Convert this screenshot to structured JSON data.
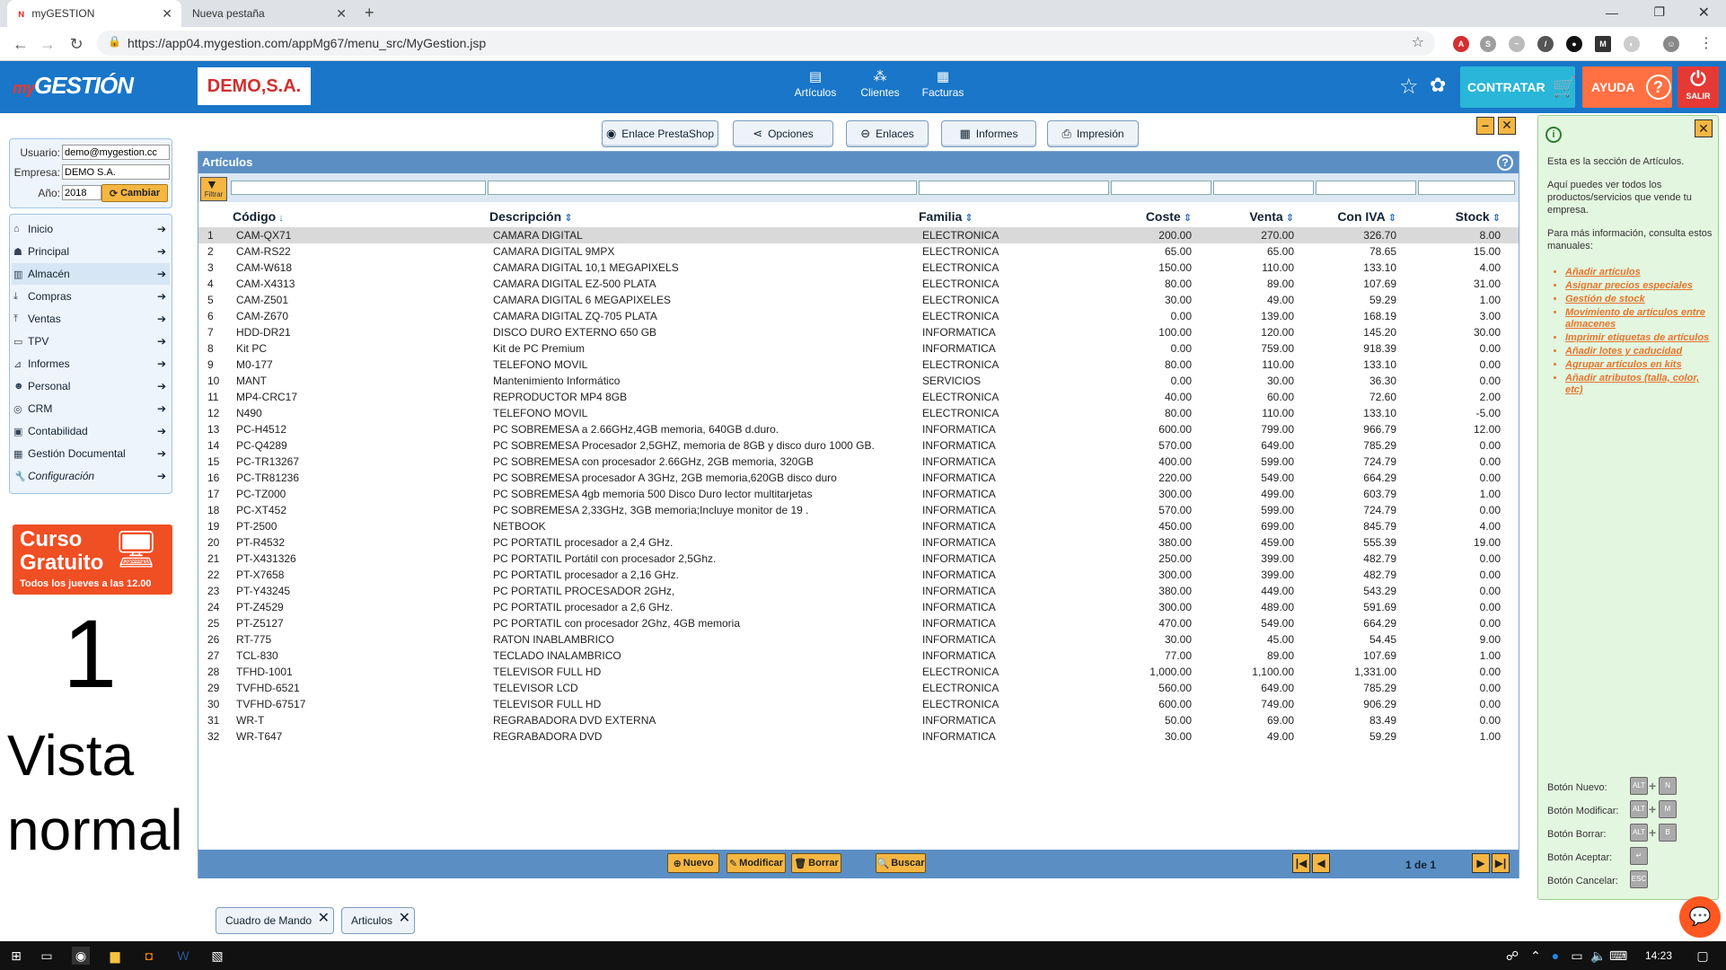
{
  "browser": {
    "tabs": [
      {
        "label": "myGESTION",
        "close": "✕"
      },
      {
        "label": "Nueva pestaña",
        "close": "✕"
      }
    ],
    "new_tab": "+",
    "url": "https://app04.mygestion.com/appMg67/menu_src/MyGestion.jsp"
  },
  "header": {
    "logo_prefix": "my",
    "logo": "GESTIÓN",
    "company_badge": "DEMO,S.A.",
    "nav": [
      {
        "label": "Artículos",
        "icon": "box-icon"
      },
      {
        "label": "Clientes",
        "icon": "people-icon"
      },
      {
        "label": "Facturas",
        "icon": "invoice-icon"
      }
    ],
    "contratar": "CONTRATAR",
    "ayuda": "AYUDA",
    "salir": "SALIR"
  },
  "login": {
    "usuario_label": "Usuario:",
    "usuario_value": "demo@mygestion.cc",
    "empresa_label": "Empresa:",
    "empresa_value": "DEMO S.A.",
    "anio_label": "Año:",
    "anio_value": "2018",
    "cambiar": "Cambiar"
  },
  "menu": [
    {
      "label": "Inicio"
    },
    {
      "label": "Principal"
    },
    {
      "label": "Almacén"
    },
    {
      "label": "Compras"
    },
    {
      "label": "Ventas"
    },
    {
      "label": "TPV"
    },
    {
      "label": "Informes"
    },
    {
      "label": "Personal"
    },
    {
      "label": "CRM"
    },
    {
      "label": "Contabilidad"
    },
    {
      "label": "Gestión Documental"
    },
    {
      "label": "Configuración"
    }
  ],
  "promo": {
    "line1": "Curso",
    "line2": "Gratuito",
    "line3": "Todos los jueves a las 12.00"
  },
  "overlay": {
    "number": "1",
    "line1": "Vista",
    "line2": "normal"
  },
  "toolbar": [
    "Enlace PrestaShop",
    "Opciones",
    "Enlaces",
    "Informes",
    "Impresión"
  ],
  "grid": {
    "title": "Artículos",
    "filter_label": "Filtrar",
    "columns": [
      "Código",
      "Descripción",
      "Familia",
      "Coste",
      "Venta",
      "Con IVA",
      "Stock"
    ],
    "rows": [
      [
        "1",
        "CAM-QX71",
        "CAMARA DIGITAL",
        "ELECTRONICA",
        "200.00",
        "270.00",
        "326.70",
        "8.00"
      ],
      [
        "2",
        "CAM-RS22",
        "CAMARA DIGITAL 9MPX",
        "ELECTRONICA",
        "65.00",
        "65.00",
        "78.65",
        "15.00"
      ],
      [
        "3",
        "CAM-W618",
        "CAMARA DIGITAL 10,1 MEGAPIXELS",
        "ELECTRONICA",
        "150.00",
        "110.00",
        "133.10",
        "4.00"
      ],
      [
        "4",
        "CAM-X4313",
        "CAMARA DIGITAL EZ-500 PLATA",
        "ELECTRONICA",
        "80.00",
        "89.00",
        "107.69",
        "31.00"
      ],
      [
        "5",
        "CAM-Z501",
        "CAMARA DIGITAL 6 MEGAPIXELES",
        "ELECTRONICA",
        "30.00",
        "49.00",
        "59.29",
        "1.00"
      ],
      [
        "6",
        "CAM-Z670",
        "CAMARA DIGITAL ZQ-705 PLATA",
        "ELECTRONICA",
        "0.00",
        "139.00",
        "168.19",
        "3.00"
      ],
      [
        "7",
        "HDD-DR21",
        "DISCO DURO EXTERNO 650 GB",
        "INFORMATICA",
        "100.00",
        "120.00",
        "145.20",
        "30.00"
      ],
      [
        "8",
        "Kit PC",
        "Kit de PC Premium",
        "INFORMATICA",
        "0.00",
        "759.00",
        "918.39",
        "0.00"
      ],
      [
        "9",
        "M0-177",
        "TELEFONO MOVIL",
        "ELECTRONICA",
        "80.00",
        "110.00",
        "133.10",
        "0.00"
      ],
      [
        "10",
        "MANT",
        "Mantenimiento Informático",
        "SERVICIOS",
        "0.00",
        "30.00",
        "36.30",
        "0.00"
      ],
      [
        "11",
        "MP4-CRC17",
        "REPRODUCTOR MP4 8GB",
        "ELECTRONICA",
        "40.00",
        "60.00",
        "72.60",
        "2.00"
      ],
      [
        "12",
        "N490",
        "TELEFONO MOVIL",
        "ELECTRONICA",
        "80.00",
        "110.00",
        "133.10",
        "-5.00"
      ],
      [
        "13",
        "PC-H4512",
        "PC SOBREMESA a 2.66GHz,4GB memoria, 640GB d.duro.",
        "INFORMATICA",
        "600.00",
        "799.00",
        "966.79",
        "12.00"
      ],
      [
        "14",
        "PC-Q4289",
        "PC SOBREMESA Procesador 2,5GHZ, memoria de 8GB y disco duro 1000 GB.",
        "INFORMATICA",
        "570.00",
        "649.00",
        "785.29",
        "0.00"
      ],
      [
        "15",
        "PC-TR13267",
        "PC SOBREMESA con procesador 2.66GHz, 2GB memoria, 320GB",
        "INFORMATICA",
        "400.00",
        "599.00",
        "724.79",
        "0.00"
      ],
      [
        "16",
        "PC-TR81236",
        "PC SOBREMESA procesador A 3GHz, 2GB memoria,620GB disco duro",
        "INFORMATICA",
        "220.00",
        "549.00",
        "664.29",
        "0.00"
      ],
      [
        "17",
        "PC-TZ000",
        "PC SOBREMESA 4gb memoria 500 Disco Duro lector multitarjetas",
        "INFORMATICA",
        "300.00",
        "499.00",
        "603.79",
        "1.00"
      ],
      [
        "18",
        "PC-XT452",
        "PC SOBREMESA 2,33GHz, 3GB memoria;Incluye monitor de 19 .",
        "INFORMATICA",
        "570.00",
        "599.00",
        "724.79",
        "0.00"
      ],
      [
        "19",
        "PT-2500",
        "NETBOOK",
        "INFORMATICA",
        "450.00",
        "699.00",
        "845.79",
        "4.00"
      ],
      [
        "20",
        "PT-R4532",
        "PC PORTATIL procesador a 2,4 GHz.",
        "INFORMATICA",
        "380.00",
        "459.00",
        "555.39",
        "19.00"
      ],
      [
        "21",
        "PT-X431326",
        "PC PORTATIL Portátil con procesador 2,5Ghz.",
        "INFORMATICA",
        "250.00",
        "399.00",
        "482.79",
        "0.00"
      ],
      [
        "22",
        "PT-X7658",
        "PC PORTATIL procesador a 2,16 GHz.",
        "INFORMATICA",
        "300.00",
        "399.00",
        "482.79",
        "0.00"
      ],
      [
        "23",
        "PT-Y43245",
        "PC PORTATIL PROCESADOR 2GHz,",
        "INFORMATICA",
        "380.00",
        "449.00",
        "543.29",
        "0.00"
      ],
      [
        "24",
        "PT-Z4529",
        "PC PORTATIL procesador a 2,6 GHz.",
        "INFORMATICA",
        "300.00",
        "489.00",
        "591.69",
        "0.00"
      ],
      [
        "25",
        "PT-Z5127",
        "PC PORTATIL con procesador 2Ghz, 4GB memoria",
        "INFORMATICA",
        "470.00",
        "549.00",
        "664.29",
        "0.00"
      ],
      [
        "26",
        "RT-775",
        "RATON INABLAMBRICO",
        "INFORMATICA",
        "30.00",
        "45.00",
        "54.45",
        "9.00"
      ],
      [
        "27",
        "TCL-830",
        "TECLADO INALAMBRICO",
        "INFORMATICA",
        "77.00",
        "89.00",
        "107.69",
        "1.00"
      ],
      [
        "28",
        "TFHD-1001",
        "TELEVISOR FULL HD",
        "ELECTRONICA",
        "1,000.00",
        "1,100.00",
        "1,331.00",
        "0.00"
      ],
      [
        "29",
        "TVFHD-6521",
        "TELEVISOR LCD",
        "ELECTRONICA",
        "560.00",
        "649.00",
        "785.29",
        "0.00"
      ],
      [
        "30",
        "TVFHD-67517",
        "TELEVISOR FULL HD",
        "ELECTRONICA",
        "600.00",
        "749.00",
        "906.29",
        "0.00"
      ],
      [
        "31",
        "WR-T",
        "REGRABADORA DVD EXTERNA",
        "INFORMATICA",
        "50.00",
        "69.00",
        "83.49",
        "0.00"
      ],
      [
        "32",
        "WR-T647",
        "REGRABADORA DVD",
        "INFORMATICA",
        "30.00",
        "49.00",
        "59.29",
        "1.00"
      ]
    ],
    "footer_buttons": [
      "Nuevo",
      "Modificar",
      "Borrar",
      "Buscar"
    ],
    "page_info": "1 de 1"
  },
  "bottom_tabs": [
    "Cuadro de Mando",
    "Articulos"
  ],
  "help": {
    "intro1": "Esta es la sección de Artículos.",
    "intro2": "Aquí puedes ver todos los productos/servicios que vende tu empresa.",
    "intro3": "Para más información, consulta estos manuales:",
    "links": [
      "Añadir artículos",
      "Asignar precios especiales",
      "Gestión de stock",
      "Movimiento de artículos entre almacenes",
      "Imprimir etiquetas de artículos",
      "Añadir lotes y caducidad",
      "Agrupar artículos en kits",
      "Añadir atributos (talla, color, etc)"
    ],
    "shortcuts": [
      {
        "label": "Botón Nuevo:",
        "keys": [
          "ALT",
          "N"
        ]
      },
      {
        "label": "Botón Modificar:",
        "keys": [
          "ALT",
          "M"
        ]
      },
      {
        "label": "Botón Borrar:",
        "keys": [
          "ALT",
          "B"
        ]
      },
      {
        "label": "Botón Aceptar:",
        "keys": [
          "↵"
        ]
      },
      {
        "label": "Botón Cancelar:",
        "keys": [
          "ESC"
        ]
      }
    ]
  },
  "taskbar": {
    "time": "14:23"
  }
}
